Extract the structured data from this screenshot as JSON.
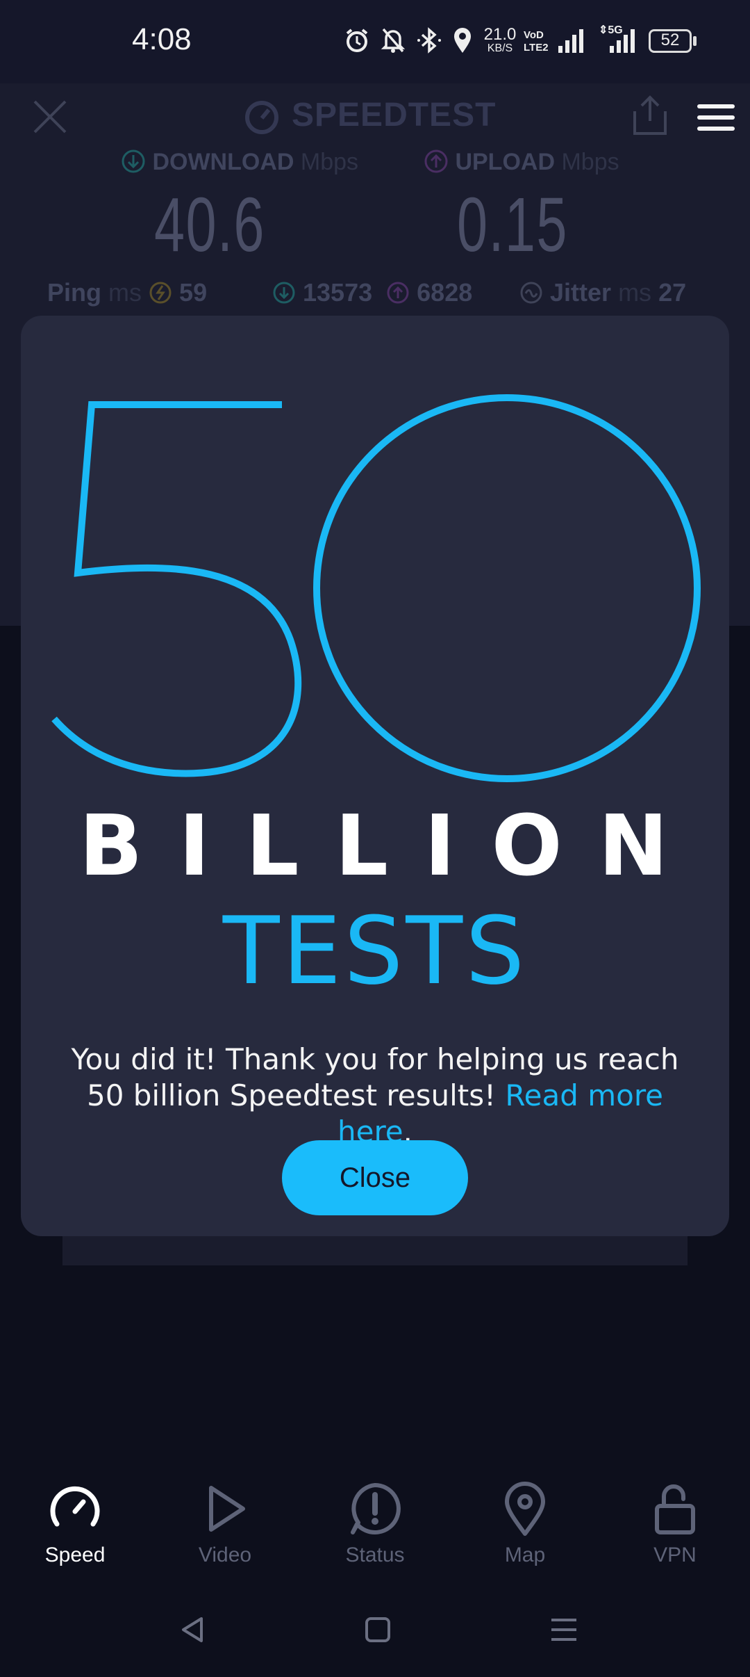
{
  "status_bar": {
    "time": "4:08",
    "net_speed_value": "21.0",
    "net_speed_unit": "KB/S",
    "volte_line1": "VoD",
    "volte_line2": "LTE2",
    "signal2_label": "5G",
    "battery": "52",
    "icons": [
      "alarm-icon",
      "bell-off-icon",
      "bluetooth-icon",
      "location-icon",
      "signal-icon"
    ]
  },
  "header": {
    "title": "SPEEDTEST",
    "download_label": "DOWNLOAD",
    "upload_label": "UPLOAD",
    "unit": "Mbps",
    "download_value": "40.6",
    "upload_value": "0.15",
    "ping_label": "Ping",
    "ping_unit": "ms",
    "ping_value": "59",
    "download_ping": "13573",
    "upload_ping": "6828",
    "jitter_label": "Jitter",
    "jitter_unit": "ms",
    "jitter_value": "27"
  },
  "modal": {
    "number": "50",
    "billion": "BILLION",
    "tests": "TESTS",
    "message": "You did it! Thank you for helping us reach 50 billion Speedtest results!",
    "link_text": "Read more here",
    "link_suffix": ".",
    "close_label": "Close",
    "accent_color": "#1ab8f5"
  },
  "bottom_nav": {
    "items": [
      {
        "label": "Speed",
        "icon": "speedometer-icon",
        "active": true
      },
      {
        "label": "Video",
        "icon": "play-icon",
        "active": false
      },
      {
        "label": "Status",
        "icon": "alert-icon",
        "active": false
      },
      {
        "label": "Map",
        "icon": "map-pin-icon",
        "active": false
      },
      {
        "label": "VPN",
        "icon": "unlock-icon",
        "active": false
      }
    ]
  },
  "system_nav": [
    "back-icon",
    "home-icon",
    "recents-icon"
  ]
}
